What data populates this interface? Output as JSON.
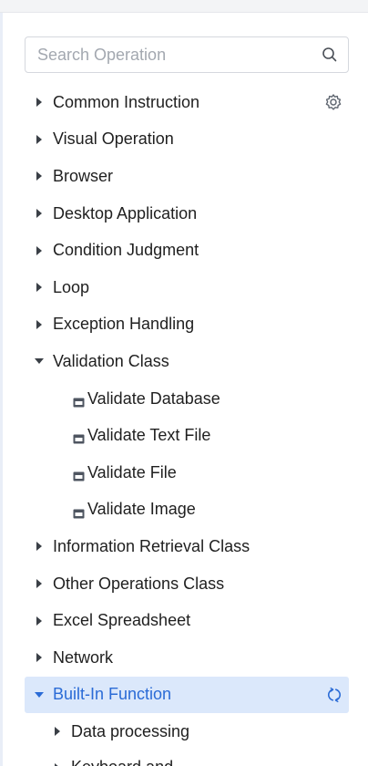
{
  "search": {
    "placeholder": "Search Operation"
  },
  "categories": [
    {
      "label": "Common Instruction",
      "expanded": false
    },
    {
      "label": "Visual Operation",
      "expanded": false
    },
    {
      "label": "Browser",
      "expanded": false
    },
    {
      "label": "Desktop Application",
      "expanded": false
    },
    {
      "label": "Condition Judgment",
      "expanded": false
    },
    {
      "label": "Loop",
      "expanded": false
    },
    {
      "label": "Exception Handling",
      "expanded": false
    },
    {
      "label": "Validation Class",
      "expanded": true,
      "children": [
        {
          "label": "Validate Database"
        },
        {
          "label": "Validate Text File"
        },
        {
          "label": "Validate File"
        },
        {
          "label": "Validate Image"
        }
      ]
    },
    {
      "label": "Information Retrieval Class",
      "expanded": false
    },
    {
      "label": "Other Operations Class",
      "expanded": false
    },
    {
      "label": "Excel Spreadsheet",
      "expanded": false
    },
    {
      "label": "Network",
      "expanded": false
    },
    {
      "label": "Built-In Function",
      "expanded": true,
      "selected": true,
      "children": [
        {
          "label": "Data processing"
        },
        {
          "label": "Keyboard and ..."
        }
      ]
    }
  ],
  "colors": {
    "accent": "#2a6bd6",
    "selected_bg": "#dbe8fb",
    "icon_gray": "#5f6670"
  },
  "icons": {
    "search": "search-icon",
    "settings": "gear-icon",
    "refresh": "refresh-icon",
    "collapsed": "caret-right-icon",
    "expanded": "caret-down-icon",
    "item": "document-icon"
  }
}
